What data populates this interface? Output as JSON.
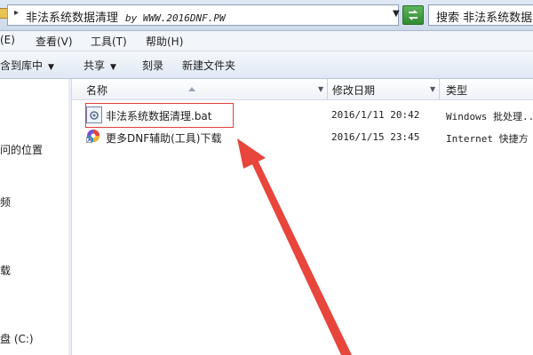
{
  "address_bar": {
    "separator": "▸",
    "path": "非法系统数据清理",
    "site": "by WWW.2016DNF.PW",
    "search_label": "搜索 非法系统数据清理"
  },
  "menu": {
    "items": [
      "(E)",
      "查看(V)",
      "工具(T)",
      "帮助(H)"
    ]
  },
  "command_bar": {
    "items": [
      "含到库中",
      "共享",
      "刻录",
      "新建文件夹"
    ],
    "caret": "▼"
  },
  "nav_pane": {
    "items": [
      "问的位置",
      "频",
      "载",
      "盘 (C:)"
    ]
  },
  "columns": {
    "name": "名称",
    "modified": "修改日期",
    "type": "类型"
  },
  "files": [
    {
      "name": "非法系统数据清理.bat",
      "modified": "2016/1/11 20:42",
      "type": "Windows 批处理..."
    },
    {
      "name": "更多DNF辅助(工具)下载",
      "modified": "2016/1/15 23:45",
      "type": "Internet 快捷方"
    }
  ],
  "colors": {
    "highlight": "#e0403a",
    "arrow": "#e8453c",
    "address_bar_bg": "#dfe9f5"
  }
}
